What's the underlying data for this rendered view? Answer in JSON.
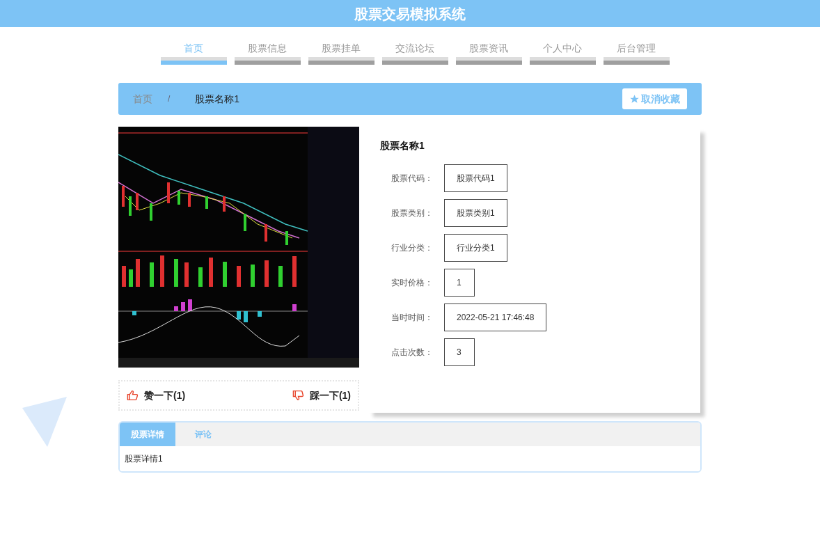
{
  "header": {
    "title": "股票交易模拟系统"
  },
  "nav": [
    {
      "label": "首页",
      "selected": true
    },
    {
      "label": "股票信息",
      "selected": false
    },
    {
      "label": "股票挂单",
      "selected": false
    },
    {
      "label": "交流论坛",
      "selected": false
    },
    {
      "label": "股票资讯",
      "selected": false
    },
    {
      "label": "个人中心",
      "selected": false
    },
    {
      "label": "后台管理",
      "selected": false
    }
  ],
  "breadcrumb": {
    "items": [
      "首页",
      "股票名称1"
    ],
    "separator": "/",
    "action": "取消收藏"
  },
  "stock": {
    "name": "股票名称1",
    "fields": [
      {
        "label": "股票代码：",
        "value": "股票代码1"
      },
      {
        "label": "股票类别：",
        "value": "股票类别1"
      },
      {
        "label": "行业分类：",
        "value": "行业分类1"
      },
      {
        "label": "实时价格：",
        "value": "1"
      },
      {
        "label": "当时时间：",
        "value": "2022-05-21 17:46:48"
      },
      {
        "label": "点击次数：",
        "value": "3"
      }
    ]
  },
  "votes": {
    "like": "赞一下(1)",
    "dislike": "踩一下(1)"
  },
  "tabs": [
    {
      "label": "股票详情",
      "selected": true
    },
    {
      "label": "评论",
      "selected": false
    }
  ],
  "tab_content": "股票详情1"
}
